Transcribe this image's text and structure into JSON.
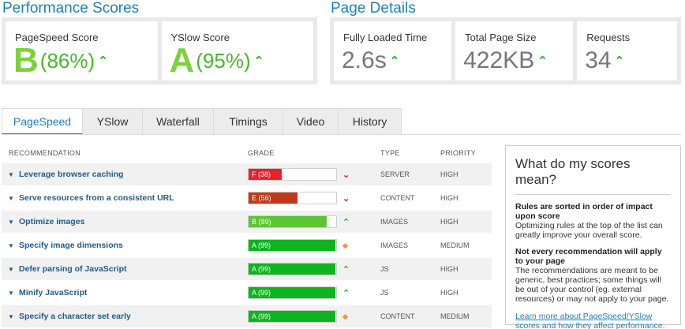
{
  "performance": {
    "title": "Performance Scores",
    "pagespeed": {
      "label": "PageSpeed Score",
      "grade": "B",
      "percent": "(86%)"
    },
    "yslow": {
      "label": "YSlow Score",
      "grade": "A",
      "percent": "(95%)"
    }
  },
  "details": {
    "title": "Page Details",
    "loaded": {
      "label": "Fully Loaded Time",
      "value": "2.6s"
    },
    "size": {
      "label": "Total Page Size",
      "value": "422KB"
    },
    "requests": {
      "label": "Requests",
      "value": "34"
    }
  },
  "tabs": [
    "PageSpeed",
    "YSlow",
    "Waterfall",
    "Timings",
    "Video",
    "History"
  ],
  "columns": {
    "rec": "RECOMMENDATION",
    "grade": "GRADE",
    "type": "TYPE",
    "priority": "PRIORITY"
  },
  "rows": [
    {
      "rec": "Leverage browser caching",
      "grade": "F (38)",
      "score": 38,
      "color": "#e8212b",
      "trend": "down",
      "type": "SERVER",
      "priority": "HIGH"
    },
    {
      "rec": "Serve resources from a consistent URL",
      "grade": "E (56)",
      "score": 56,
      "color": "#c0391b",
      "trend": "down",
      "type": "CONTENT",
      "priority": "HIGH"
    },
    {
      "rec": "Optimize images",
      "grade": "B (89)",
      "score": 89,
      "color": "#5cc534",
      "trend": "up",
      "type": "IMAGES",
      "priority": "HIGH"
    },
    {
      "rec": "Specify image dimensions",
      "grade": "A (99)",
      "score": 99,
      "color": "#0fb21f",
      "trend": "same",
      "type": "IMAGES",
      "priority": "MEDIUM"
    },
    {
      "rec": "Defer parsing of JavaScript",
      "grade": "A (99)",
      "score": 99,
      "color": "#0fb21f",
      "trend": "up",
      "type": "JS",
      "priority": "HIGH"
    },
    {
      "rec": "Minify JavaScript",
      "grade": "A (99)",
      "score": 99,
      "color": "#0fb21f",
      "trend": "up",
      "type": "JS",
      "priority": "HIGH"
    },
    {
      "rec": "Specify a character set early",
      "grade": "A (99)",
      "score": 99,
      "color": "#0fb21f",
      "trend": "same",
      "type": "CONTENT",
      "priority": "MEDIUM"
    }
  ],
  "sidebar": {
    "title": "What do my scores mean?",
    "block1_title": "Rules are sorted in order of impact upon score",
    "block1_text": "Optimizing rules at the top of the list can greatly improve your overall score.",
    "block2_title": "Not every recommendation will apply to your page",
    "block2_text": "The recommendations are meant to be generic, best practices; some things will be out of your control (eg. external resources) or may not apply to your page.",
    "link": "Learn more about PageSpeed/YSlow scores and how they affect performance."
  },
  "colors": {
    "accent": "#1e7fc0",
    "up": "#2cb52c",
    "down": "#d6264a",
    "same": "#f29a2e"
  }
}
